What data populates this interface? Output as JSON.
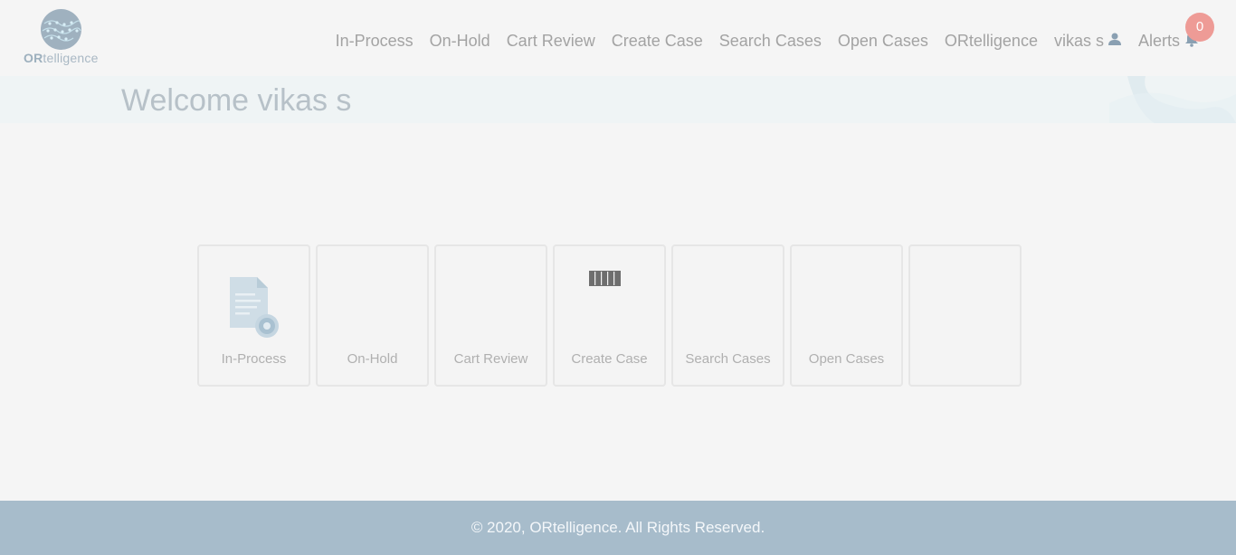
{
  "header": {
    "logo": {
      "brand_bold": "OR",
      "brand_rest": "telligence",
      "icon": "dna-globe-logo"
    },
    "nav": [
      {
        "label": "In-Process"
      },
      {
        "label": "On-Hold"
      },
      {
        "label": "Cart Review"
      },
      {
        "label": "Create Case"
      },
      {
        "label": "Search Cases"
      },
      {
        "label": "Open Cases"
      },
      {
        "label": "ORtelligence"
      }
    ],
    "user": {
      "label": "vikas s",
      "icon": "user-icon"
    },
    "alerts": {
      "label": "Alerts",
      "icon": "bell-icon",
      "count": "0"
    }
  },
  "welcome": {
    "text": "Welcome vikas s"
  },
  "tiles": [
    {
      "label": "In-Process",
      "icon": "document-gear-icon"
    },
    {
      "label": "On-Hold",
      "icon": ""
    },
    {
      "label": "Cart Review",
      "icon": ""
    },
    {
      "label": "Create Case",
      "icon": "barcode-icon"
    },
    {
      "label": "Search Cases",
      "icon": ""
    },
    {
      "label": "Open Cases",
      "icon": ""
    },
    {
      "label": "",
      "icon": ""
    }
  ],
  "footer": {
    "text": "© 2020, ORtelligence. All Rights Reserved."
  },
  "colors": {
    "background": "#f5f5f5",
    "nav_text": "#a3a3a3",
    "badge": "#ee9b96",
    "footer": "#a7bccb",
    "welcome_band": "#eff4f5"
  }
}
